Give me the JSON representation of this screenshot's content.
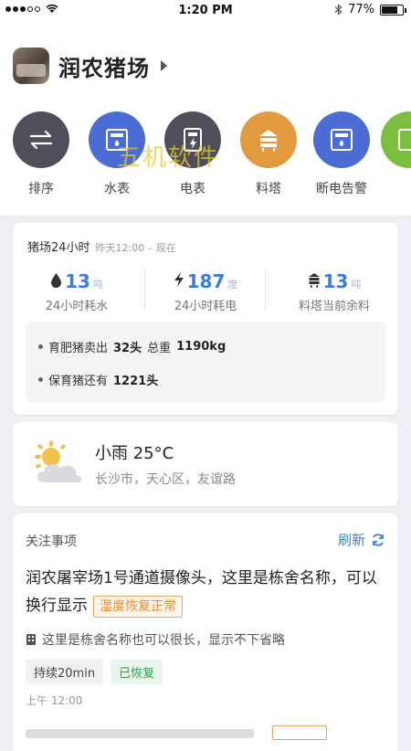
{
  "status_bar": {
    "time": "1:20 PM",
    "battery": "77%",
    "battery_level": 0.77
  },
  "farm": {
    "name": "润农猪场"
  },
  "quick_actions": [
    {
      "label": "排序",
      "icon": "swap-icon",
      "color": "#4f4f5c"
    },
    {
      "label": "水表",
      "icon": "water-meter-icon",
      "color": "#4a6cd4"
    },
    {
      "label": "电表",
      "icon": "electric-meter-icon",
      "color": "#4f4f5c"
    },
    {
      "label": "料塔",
      "icon": "feed-tower-icon",
      "color": "#e39a3f"
    },
    {
      "label": "断电告警",
      "icon": "power-alarm-icon",
      "color": "#4a6cd4"
    },
    {
      "label": "",
      "icon": "more-icon",
      "color": "#7cbf3f"
    }
  ],
  "watermark": "五机软件",
  "stats": {
    "title": "猪场24小时",
    "range": "昨天12:00 – 现在",
    "items": [
      {
        "value": "13",
        "unit": "吨",
        "desc": "24小时耗水",
        "icon": "water-drop-icon"
      },
      {
        "value": "187",
        "unit": "度",
        "desc": "24小时耗电",
        "icon": "lightning-icon"
      },
      {
        "value": "13",
        "unit": "吨",
        "desc": "料塔当前余料",
        "icon": "silo-icon"
      }
    ],
    "summary": {
      "line1_prefix": "育肥猪卖出",
      "line1_count": "32头",
      "line1_mid": "总重",
      "line1_weight": "1190kg",
      "line2_prefix": "保育猪还有",
      "line2_count": "1221头"
    }
  },
  "weather": {
    "condition_temp": "小雨 25°C",
    "location": "长沙市，天心区，友谊路",
    "icon": "partly-cloudy-icon"
  },
  "alerts": {
    "title": "关注事项",
    "refresh_label": "刷新",
    "item": {
      "text": "润农屠宰场1号通道摄像头，这里是栋舍名称，可以换行显示",
      "tag": "湿度恢复正常",
      "location": "这里是栋舍名称也可以很长，显示不下省略",
      "duration": "持续20min",
      "state": "已恢复",
      "time": "上午 12:00"
    }
  }
}
